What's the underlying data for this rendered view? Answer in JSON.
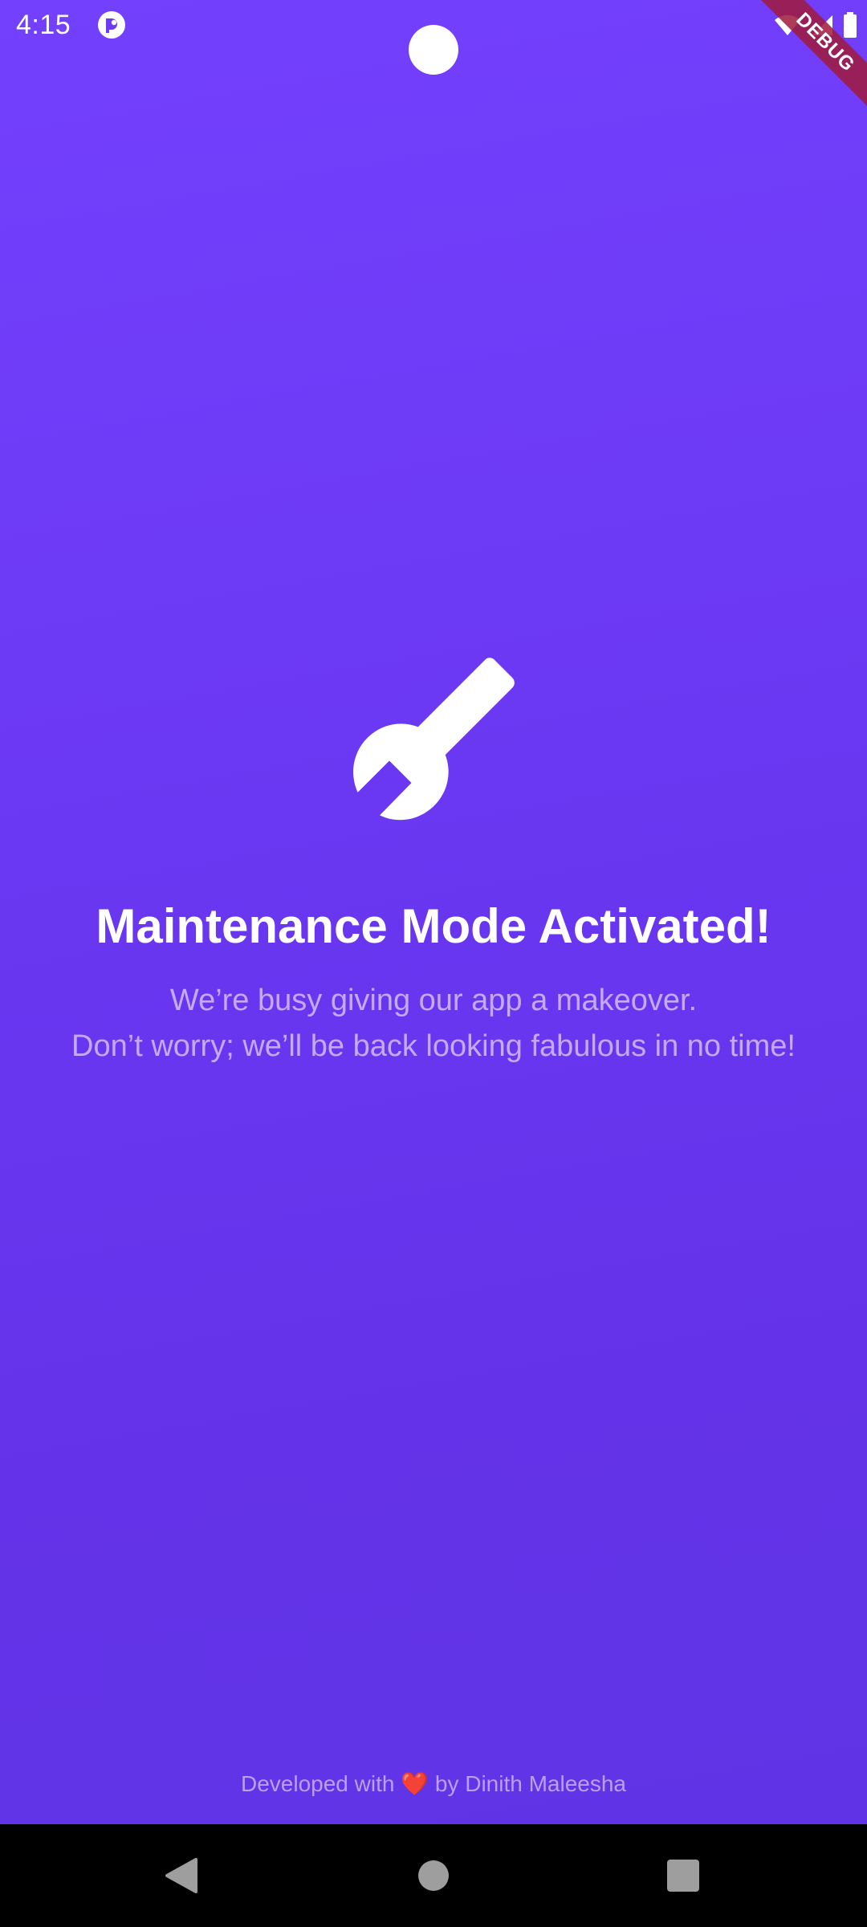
{
  "status_bar": {
    "time": "4:15",
    "app_icon": "sync-app-icon",
    "wifi_icon": "wifi-icon",
    "signal_icon": "signal-icon",
    "battery_icon": "battery-icon"
  },
  "debug_banner": {
    "label": "DEBUG"
  },
  "maintenance": {
    "icon": "wrench-icon",
    "title": "Maintenance Mode Activated!",
    "message_line1": "We’re busy giving our app a makeover.",
    "message_line2": "Don’t worry; we’ll be back looking fabulous in no time!"
  },
  "footer": {
    "prefix": "Developed with",
    "heart": "❤️",
    "suffix": "by Dinith Maleesha"
  },
  "nav_bar": {
    "back_icon": "back-icon",
    "home_icon": "home-icon",
    "recents_icon": "recents-icon"
  },
  "colors": {
    "background_top": "#7340fd",
    "background_bottom": "#6034e6",
    "title": "#ffffff",
    "message": "#c4aaf5",
    "footer": "#bba0f2",
    "debug_ribbon": "#a01a3c"
  }
}
